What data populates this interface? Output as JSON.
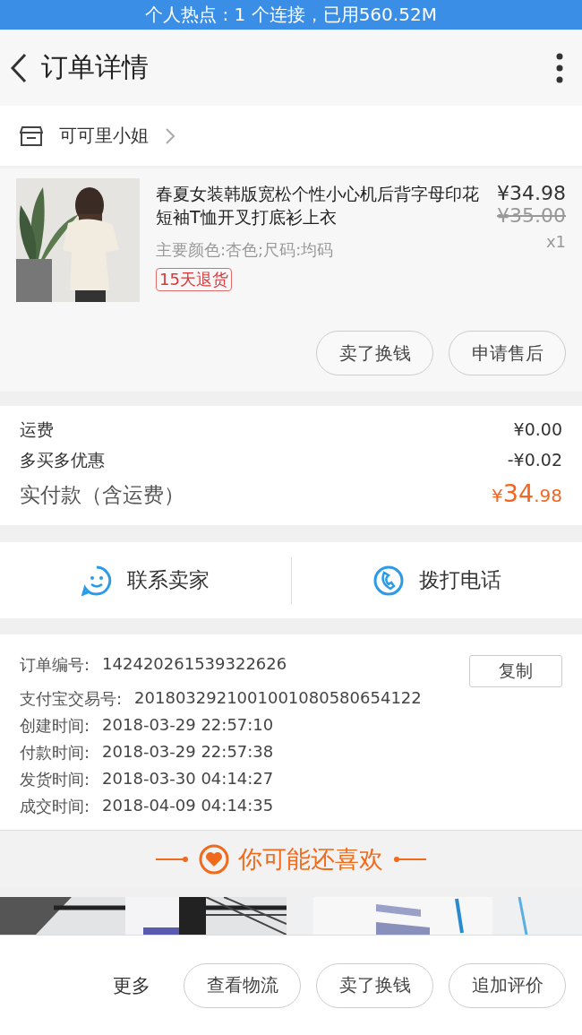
{
  "status_bar": {
    "text": "个人热点 : 1 个连接，已用560.52M"
  },
  "header": {
    "title": "订单详情"
  },
  "shop": {
    "name": "可可里小姐"
  },
  "product": {
    "kind": "picture",
    "title": "春夏女装韩版宽松个性小心机后背字母印花短袖T恤开叉打底衫上衣",
    "spec": "主要颜色:杏色;尺码:均码",
    "tag": "15天退货",
    "price": "¥34.98",
    "original_price": "¥35.00",
    "quantity": "x1",
    "buttons": [
      "卖了换钱",
      "申请售后"
    ]
  },
  "costs": [
    {
      "label": "运费",
      "value": "¥0.00"
    },
    {
      "label": "多买多优惠",
      "value": "-¥0.02"
    }
  ],
  "total": {
    "label": "实付款（含运费）",
    "currency": "¥",
    "integer": "34",
    "decimal": ".98"
  },
  "contact": [
    {
      "kind": "chat",
      "label": "联系卖家"
    },
    {
      "kind": "phone",
      "label": "拨打电话"
    }
  ],
  "order_info": {
    "copy_button": "复制",
    "rows": [
      {
        "label": "订单编号:",
        "value": "142420261539322626"
      },
      {
        "label": "支付宝交易号:",
        "value": "2018032921001001080580654122"
      },
      {
        "label": "创建时间:",
        "value": "2018-03-29 22:57:10"
      },
      {
        "label": "付款时间:",
        "value": "2018-03-29 22:57:38"
      },
      {
        "label": "发货时间:",
        "value": "2018-03-30 04:14:27"
      },
      {
        "label": "成交时间:",
        "value": "2018-04-09 04:14:35"
      }
    ]
  },
  "recommend": {
    "title": "你可能还喜欢"
  },
  "bottom_bar": {
    "more": "更多",
    "buttons": [
      "查看物流",
      "卖了换钱",
      "追加评价"
    ]
  }
}
